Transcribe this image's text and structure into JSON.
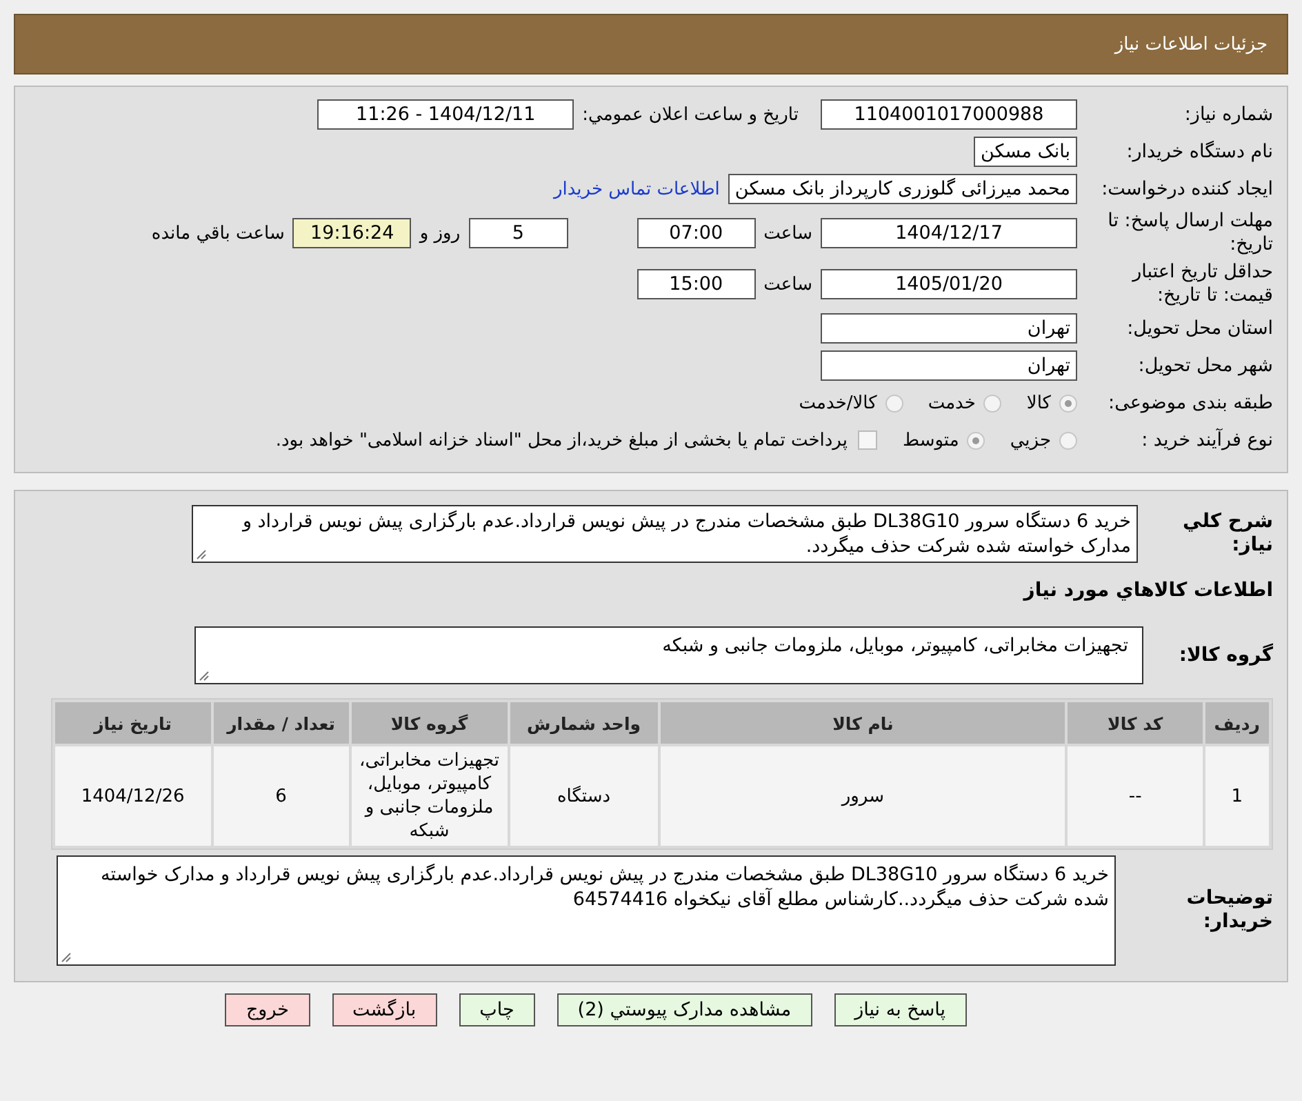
{
  "header": {
    "title": "جزئیات اطلاعات نیاز"
  },
  "need_number": {
    "label": "شماره نیاز:",
    "value": "1104001017000988"
  },
  "announce": {
    "label": "تاریخ و ساعت اعلان عمومي:",
    "value": "1404/12/11 - 11:26"
  },
  "buyer_org": {
    "label": "نام دستگاه خريدار:",
    "value": "بانک مسکن"
  },
  "requester": {
    "label": "ایجاد کننده درخواست:",
    "value": "محمد میرزائی گلوزری کارپرداز بانک مسکن",
    "link": "اطلاعات تماس خريدار"
  },
  "deadline": {
    "label": "مهلت ارسال پاسخ: تا تاریخ:",
    "date": "1404/12/17",
    "time_label": "ساعت",
    "time": "07:00",
    "days": "5",
    "days_label": "روز و",
    "remaining": "19:16:24",
    "remaining_label": "ساعت باقي مانده"
  },
  "validity": {
    "label": "حداقل تاريخ اعتبار قیمت: تا تاریخ:",
    "date": "1405/01/20",
    "time_label": "ساعت",
    "time": "15:00"
  },
  "province": {
    "label": "استان محل تحویل:",
    "value": "تهران"
  },
  "city": {
    "label": "شهر محل تحویل:",
    "value": "تهران"
  },
  "category": {
    "label": "طبقه بندی موضوعی:",
    "options": [
      {
        "label": "کالا",
        "selected": true
      },
      {
        "label": "خدمت",
        "selected": false
      },
      {
        "label": "کالا/خدمت",
        "selected": false
      }
    ]
  },
  "process": {
    "label": "نوع فرآيند خريد :",
    "options": [
      {
        "label": "جزيي",
        "selected": false
      },
      {
        "label": "متوسط",
        "selected": true
      }
    ],
    "payment": {
      "label": "پرداخت تمام يا بخشی از مبلغ خريد،از محل \"اسناد خزانه اسلامی\" خواهد بود.",
      "checked": false
    }
  },
  "summary": {
    "label": "شرح کلي نياز:",
    "value": "خرید 6 دستگاه سرور DL38G10 طبق مشخصات مندرج در پیش نویس قرارداد.عدم بارگزاری پیش نویس قرارداد و مدارک خواسته شده شرکت حذف میگردد."
  },
  "goods_heading": "اطلاعات کالاهاي مورد نياز",
  "goods_group": {
    "label": "گروه کالا:",
    "value": "تجهیزات مخابراتی، کامپیوتر، موبایل، ملزومات جانبی و شبکه"
  },
  "table": {
    "columns": [
      "رديف",
      "کد کالا",
      "نام کالا",
      "واحد شمارش",
      "گروه کالا",
      "تعداد / مقدار",
      "تاريخ نياز"
    ],
    "rows": [
      [
        "1",
        "--",
        "سرور",
        "دستگاه",
        "تجهیزات مخابراتی، کامپیوتر، موبایل، ملزومات جانبی و شبکه",
        "6",
        "1404/12/26"
      ]
    ]
  },
  "buyer_notes": {
    "label": "توضيحات خريدار:",
    "value": "خرید 6 دستگاه سرور DL38G10 طبق مشخصات مندرج در پیش نویس قرارداد.عدم بارگزاری پیش نویس قرارداد و مدارک خواسته شده شرکت حذف میگردد..کارشناس مطلع آقای نیکخواه 64574416"
  },
  "buttons": [
    {
      "label": "پاسخ به نياز",
      "kind": "primary"
    },
    {
      "label": "مشاهده مدارک پيوستي (2)",
      "kind": "primary"
    },
    {
      "label": "چاپ",
      "kind": "primary"
    },
    {
      "label": "بازگشت",
      "kind": "danger"
    },
    {
      "label": "خروج",
      "kind": "danger"
    }
  ]
}
